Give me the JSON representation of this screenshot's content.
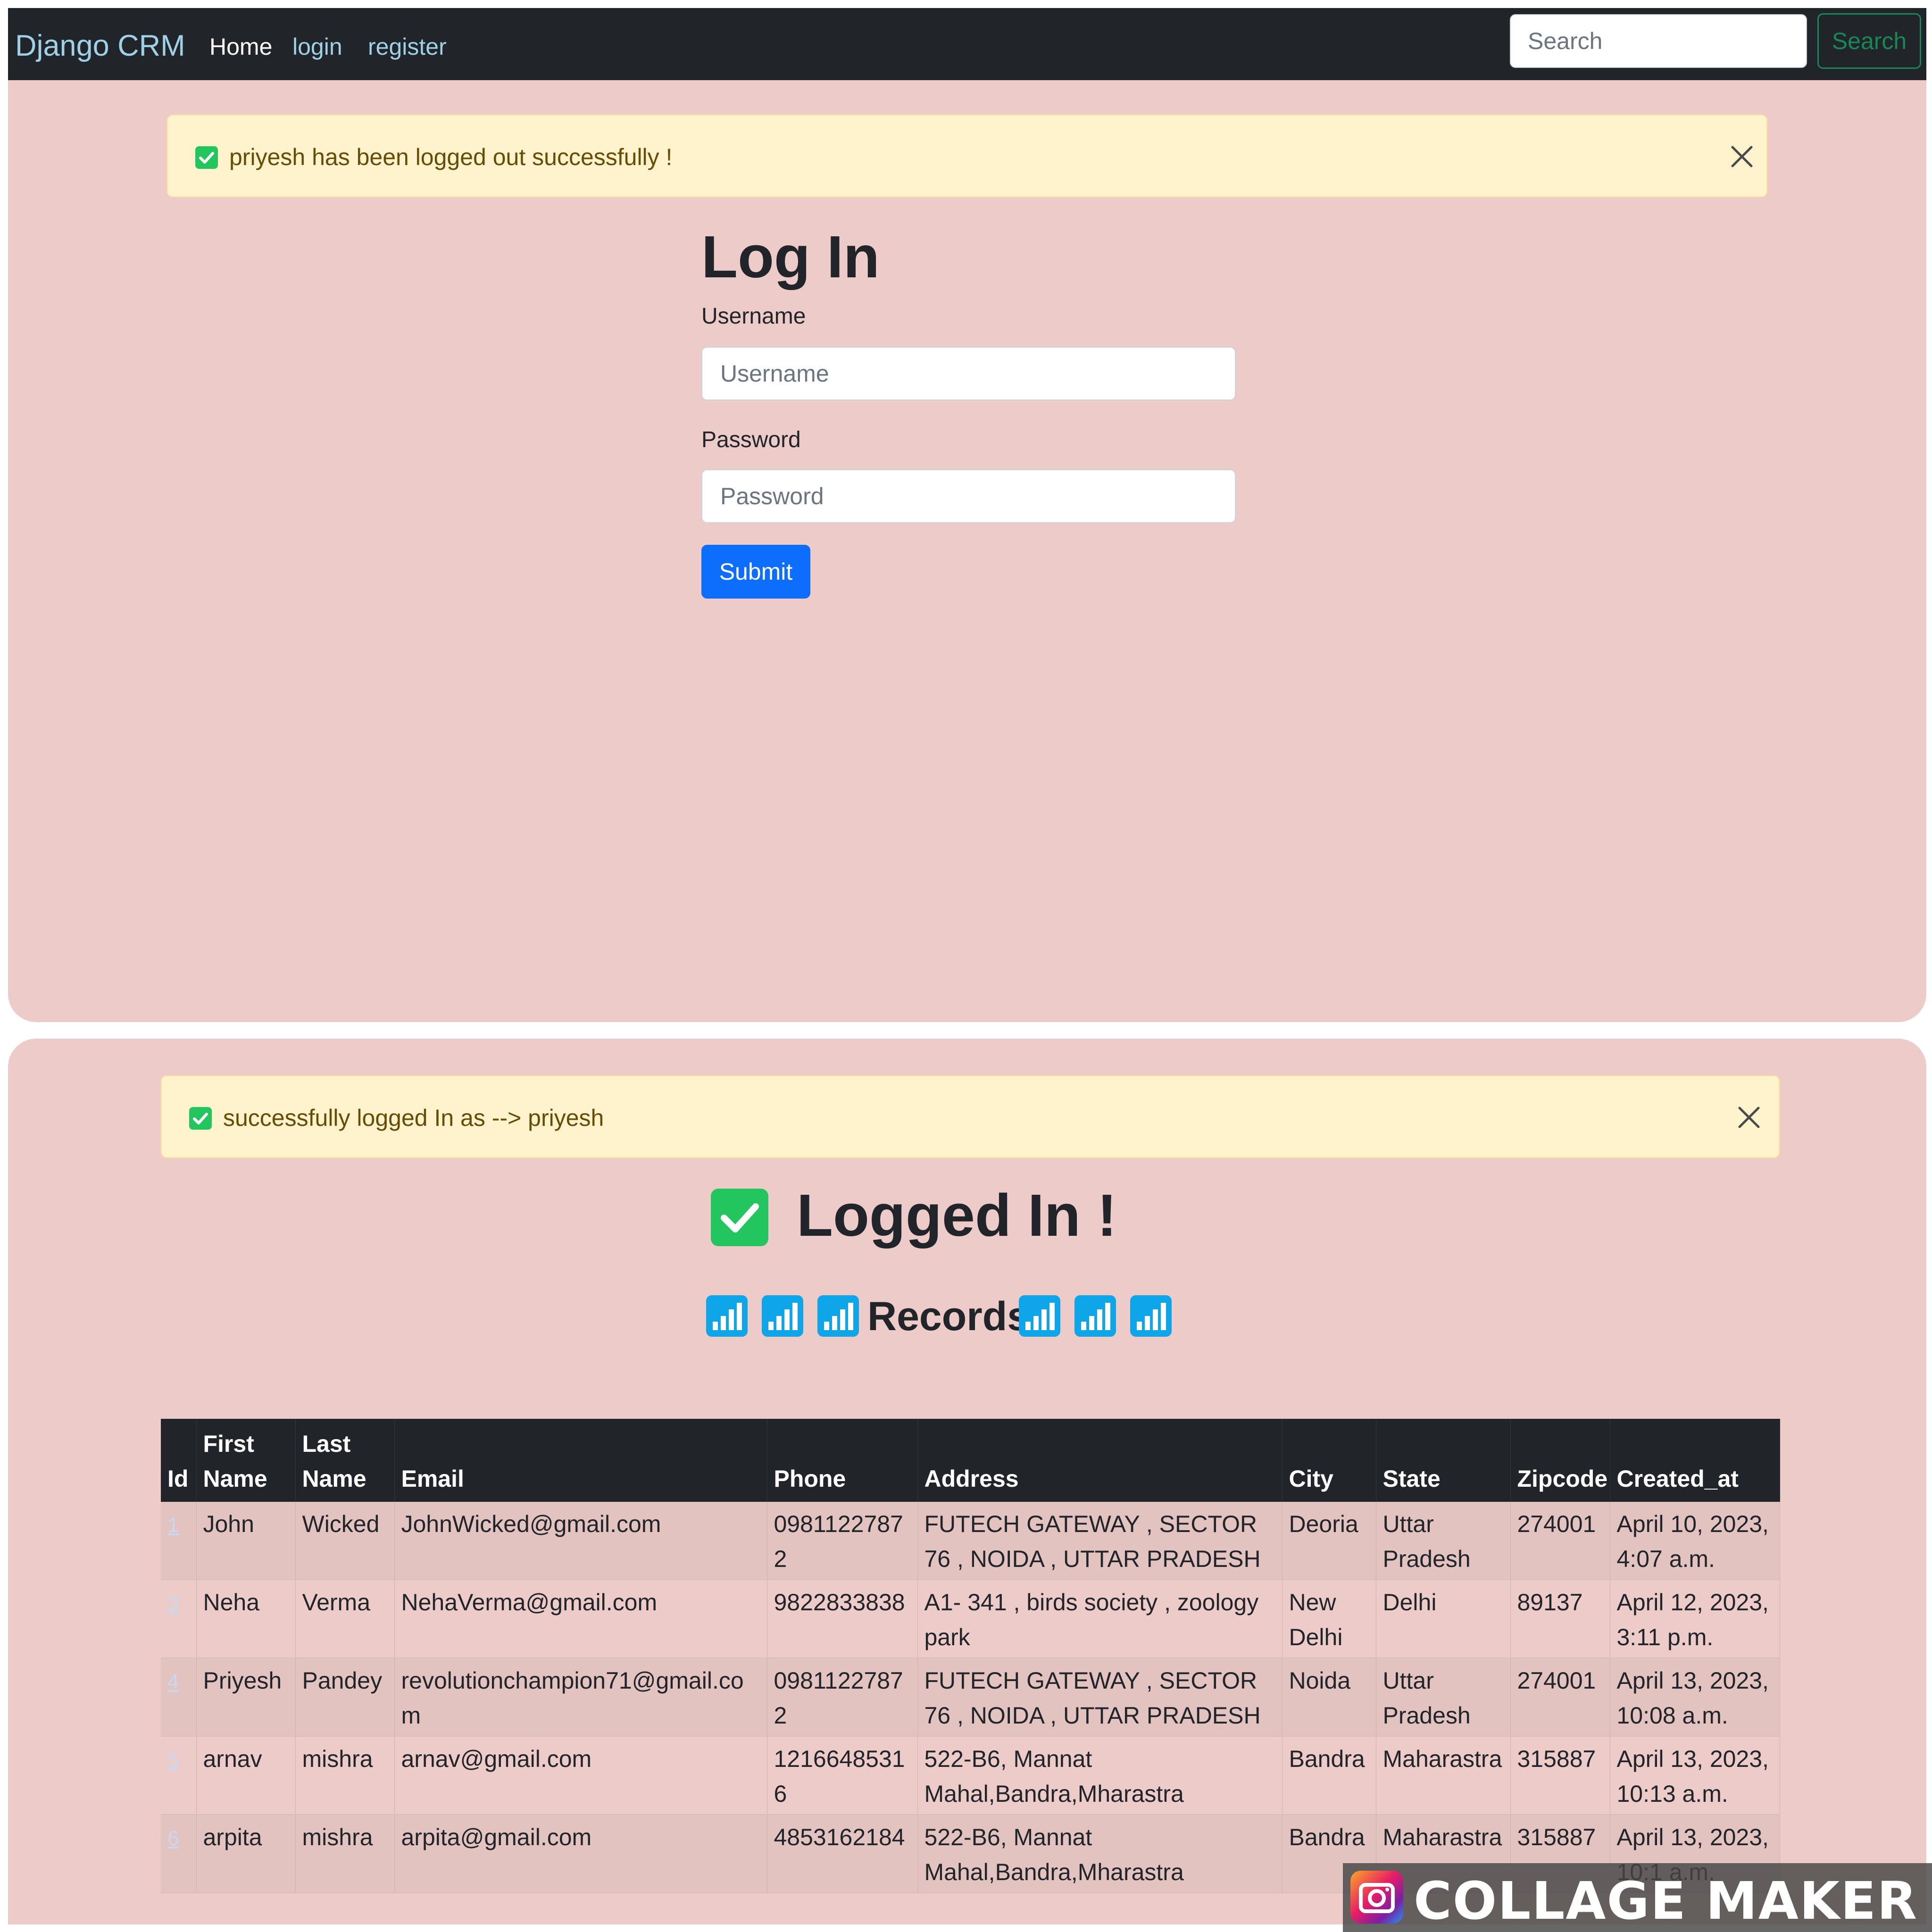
{
  "top_screen": {
    "navbar": {
      "brand": "Django CRM",
      "links": [
        "Home",
        "login",
        "register"
      ],
      "search_placeholder": "Search",
      "search_button": "Search"
    },
    "alert": {
      "message": "priyesh has been logged out successfully !"
    },
    "login_form": {
      "title": "Log In",
      "username_label": "Username",
      "username_placeholder": "Username",
      "password_label": "Password",
      "password_placeholder": "Password",
      "submit_label": "Submit"
    }
  },
  "bottom_screen": {
    "alert": {
      "message": "successfully logged In as --> priyesh"
    },
    "title": "Logged In !",
    "records_heading": "Records",
    "table": {
      "headers": [
        "Id",
        "First Name",
        "Last Name",
        "Email",
        "Phone",
        "Address",
        "City",
        "State",
        "Zipcode",
        "Created_at"
      ],
      "rows": [
        [
          "1",
          "John",
          "Wicked",
          "JohnWicked@gmail.com",
          "09811227872",
          "FUTECH GATEWAY , SECTOR 76 , NOIDA , UTTAR PRADESH",
          "Deoria",
          "Uttar Pradesh",
          "274001",
          "April 10, 2023, 4:07 a.m."
        ],
        [
          "3",
          "Neha",
          "Verma",
          "NehaVerma@gmail.com",
          "9822833838",
          "A1- 341 , birds society , zoology park",
          "New Delhi",
          "Delhi",
          "89137",
          "April 12, 2023, 3:11 p.m."
        ],
        [
          "4",
          "Priyesh",
          "Pandey",
          "revolutionchampion71@gmail.com",
          "09811227872",
          "FUTECH GATEWAY , SECTOR 76 , NOIDA , UTTAR PRADESH",
          "Noida",
          "Uttar Pradesh",
          "274001",
          "April 13, 2023, 10:08 a.m."
        ],
        [
          "5",
          "arnav",
          "mishra",
          "arnav@gmail.com",
          "12166485316",
          "522-B6, Mannat Mahal,Bandra,Mharastra",
          "Bandra",
          "Maharastra",
          "315887",
          "April 13, 2023, 10:13 a.m."
        ],
        [
          "6",
          "arpita",
          "mishra",
          "arpita@gmail.com",
          "4853162184",
          "522-B6, Mannat Mahal,Bandra,Mharastra",
          "Bandra",
          "Maharastra",
          "315887",
          "April 13, 2023, 10:1 a.m."
        ]
      ]
    }
  },
  "watermark": {
    "text": "COLLAGE MAKER"
  },
  "colors": {
    "page_bg": "#eccbc8",
    "navbar_bg": "#212529",
    "alert_bg": "#fff3cd",
    "primary": "#0d6efd",
    "success": "#198754",
    "check_green": "#22c55e",
    "chart_blue": "#0ea5e9"
  },
  "icons": [
    "check-square-icon",
    "close-icon",
    "bar-chart-icon",
    "collage-app-icon"
  ]
}
